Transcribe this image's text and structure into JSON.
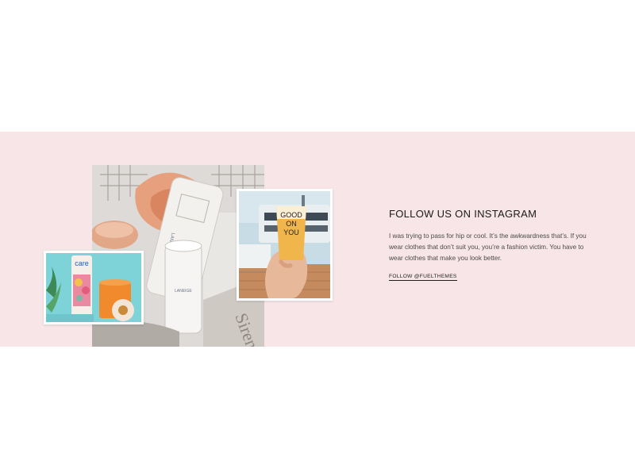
{
  "instagram": {
    "heading": "FOLLOW US ON INSTAGRAM",
    "body": "I was trying to pass for hip or cool. It’s the awkwardness that’s. If you wear clothes that don’t suit you, you’re a fashion victim. You have to wear clothes that make you look better.",
    "follow_label": "FOLLOW @FUELTHEMES"
  },
  "photos": {
    "main": {
      "brand_text": "LANEIGE"
    },
    "right": {
      "cup_text": [
        "GOOD",
        "ON",
        "YOU"
      ]
    },
    "left": {
      "tube_text": "care"
    }
  },
  "colors": {
    "band_background": "#f7e5e8",
    "heading": "#1b1b1b",
    "body": "#4a4a4a"
  }
}
